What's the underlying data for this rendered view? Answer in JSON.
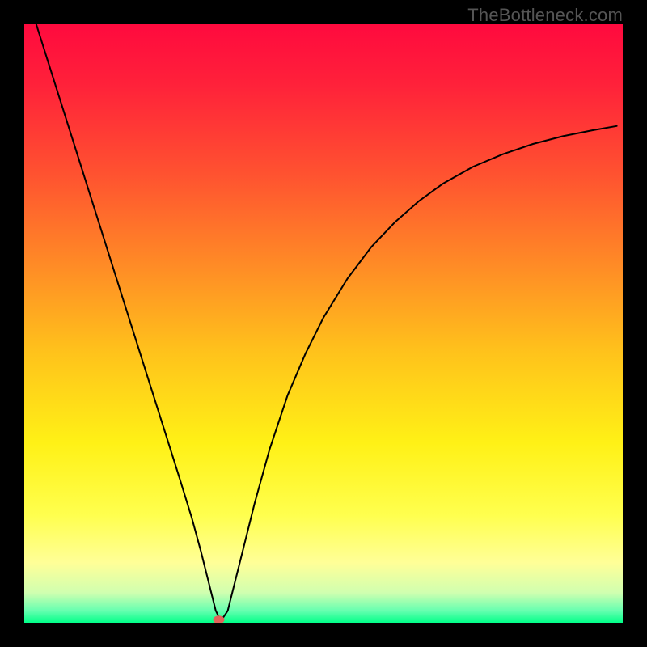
{
  "watermark": "TheBottleneck.com",
  "chart_data": {
    "type": "line",
    "title": "",
    "xlabel": "",
    "ylabel": "",
    "xlim": [
      0,
      1
    ],
    "ylim": [
      0,
      1
    ],
    "background_gradient": {
      "type": "linear-vertical",
      "stops": [
        {
          "pos": 0.0,
          "color": "#ff0a3e"
        },
        {
          "pos": 0.1,
          "color": "#ff213a"
        },
        {
          "pos": 0.25,
          "color": "#ff5230"
        },
        {
          "pos": 0.4,
          "color": "#ff8a26"
        },
        {
          "pos": 0.55,
          "color": "#ffc31b"
        },
        {
          "pos": 0.7,
          "color": "#fff116"
        },
        {
          "pos": 0.82,
          "color": "#ffff4e"
        },
        {
          "pos": 0.9,
          "color": "#ffff98"
        },
        {
          "pos": 0.95,
          "color": "#d0ffb0"
        },
        {
          "pos": 0.98,
          "color": "#66ffb0"
        },
        {
          "pos": 1.0,
          "color": "#00ff88"
        }
      ]
    },
    "series": [
      {
        "name": "bottleneck-curve",
        "color": "#000000",
        "stroke_width": 2,
        "x": [
          0.02,
          0.05,
          0.08,
          0.11,
          0.14,
          0.17,
          0.2,
          0.23,
          0.26,
          0.28,
          0.295,
          0.305,
          0.315,
          0.32,
          0.325,
          0.33,
          0.34,
          0.35,
          0.365,
          0.385,
          0.41,
          0.44,
          0.47,
          0.5,
          0.54,
          0.58,
          0.62,
          0.66,
          0.7,
          0.75,
          0.8,
          0.85,
          0.9,
          0.95,
          0.99
        ],
        "y": [
          1.0,
          0.905,
          0.81,
          0.715,
          0.62,
          0.525,
          0.43,
          0.335,
          0.24,
          0.175,
          0.12,
          0.08,
          0.04,
          0.02,
          0.01,
          0.005,
          0.02,
          0.06,
          0.12,
          0.2,
          0.29,
          0.38,
          0.45,
          0.51,
          0.575,
          0.628,
          0.67,
          0.705,
          0.734,
          0.762,
          0.783,
          0.8,
          0.813,
          0.823,
          0.83
        ]
      }
    ],
    "marker": {
      "name": "min-point",
      "x": 0.325,
      "y": 0.005,
      "color": "#e2635a",
      "rx": 7,
      "ry": 5
    }
  }
}
